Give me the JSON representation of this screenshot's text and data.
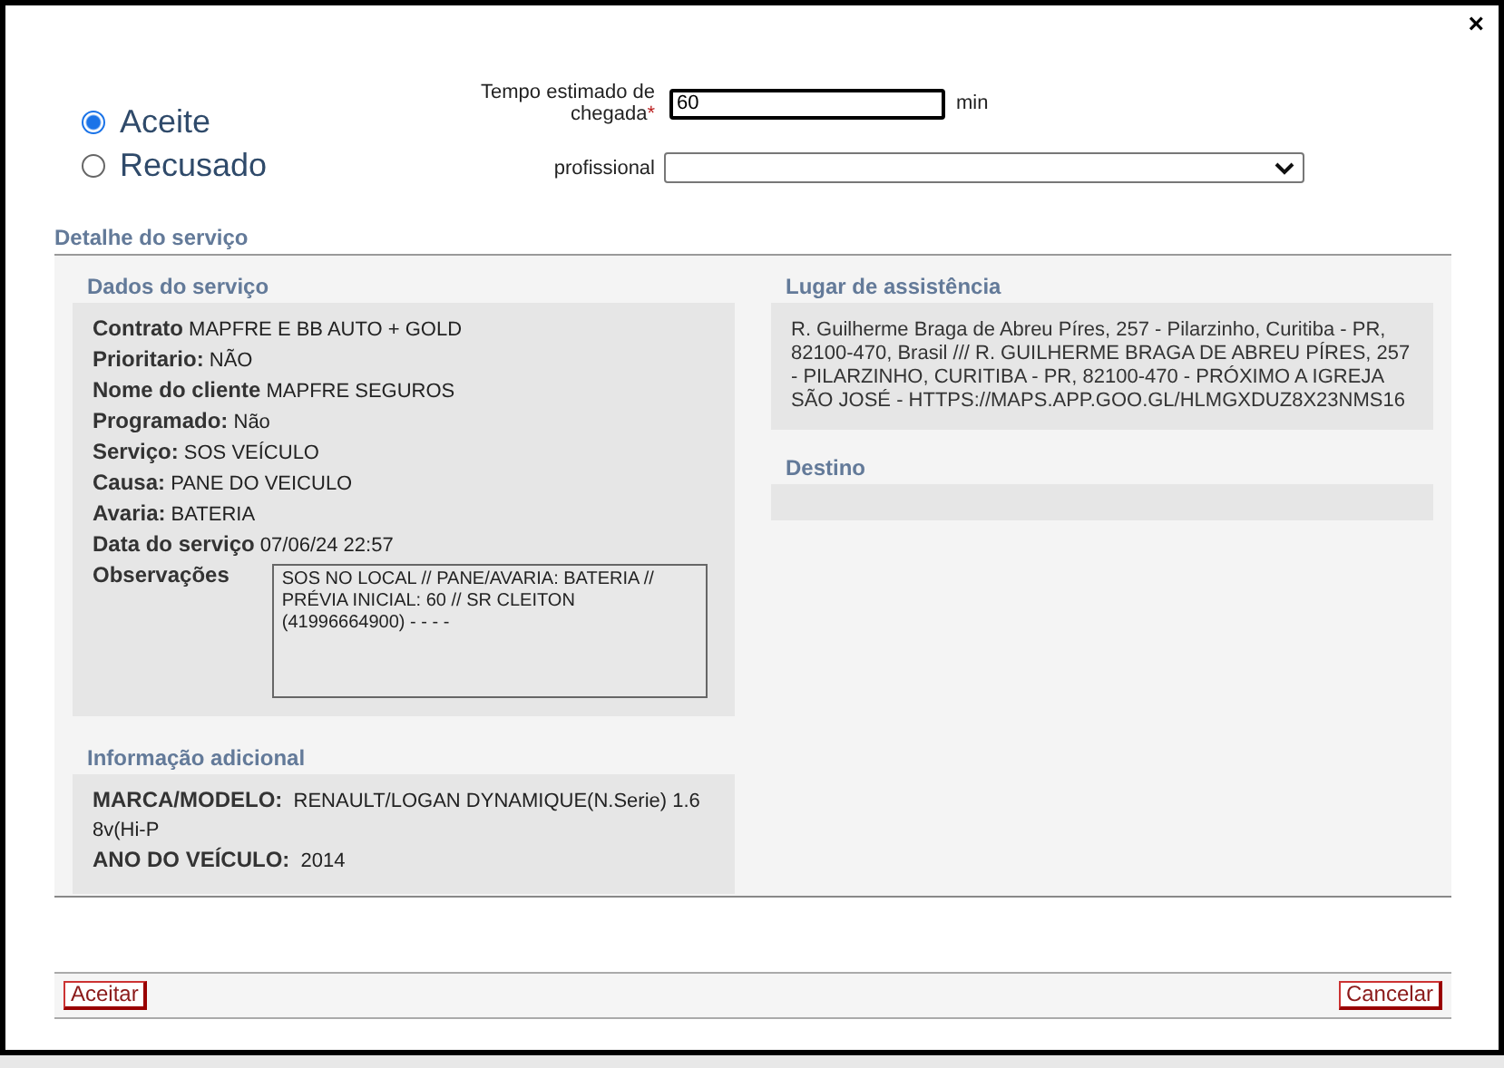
{
  "close": "×",
  "status_options": [
    {
      "label": "Aceite",
      "selected": true
    },
    {
      "label": "Recusado",
      "selected": false
    }
  ],
  "eta": {
    "label": "Tempo estimado de chegada",
    "required_mark": "*",
    "value": "60",
    "unit": "min"
  },
  "professional": {
    "label": "profissional"
  },
  "detail_title": "Detalhe do serviço",
  "service_data": {
    "title": "Dados do serviço",
    "fields": [
      {
        "label": "Contrato",
        "value": "MAPFRE E BB AUTO + GOLD"
      },
      {
        "label": "Prioritario:",
        "value": "NÃO"
      },
      {
        "label": "Nome do cliente",
        "value": "MAPFRE SEGUROS"
      },
      {
        "label": "Programado:",
        "value": "Não"
      },
      {
        "label": "Serviço:",
        "value": "SOS VEÍCULO"
      },
      {
        "label": "Causa:",
        "value": "PANE DO VEICULO"
      },
      {
        "label": "Avaria:",
        "value": "BATERIA"
      },
      {
        "label": "Data do serviço",
        "value": "07/06/24 22:57"
      }
    ],
    "notes_label": "Observações",
    "notes": "SOS NO LOCAL // PANE/AVARIA: BATERIA // PRÉVIA INICIAL: 60 // SR CLEITON (41996664900) - - - -"
  },
  "additional_info": {
    "title": "Informação adicional",
    "fields": [
      {
        "label": "MARCA/MODELO:",
        "value": "RENAULT/LOGAN DYNAMIQUE(N.Serie) 1.6 8v(Hi-P"
      },
      {
        "label": "ANO DO VEÍCULO:",
        "value": "2014"
      }
    ]
  },
  "assistance_place": {
    "title": "Lugar de assistência",
    "text": "R. Guilherme Braga de Abreu Píres, 257 - Pilarzinho, Curitiba - PR, 82100-470, Brasil /// R. GUILHERME BRAGA DE ABREU PÍRES, 257 - PILARZINHO, CURITIBA - PR, 82100-470 - PRÓXIMO A IGREJA SÃO JOSÉ - HTTPS://MAPS.APP.GOO.GL/HLMGXDUZ8X23NMS16"
  },
  "destination": {
    "title": "Destino"
  },
  "buttons": [
    "Aceitar",
    "Cancelar"
  ]
}
